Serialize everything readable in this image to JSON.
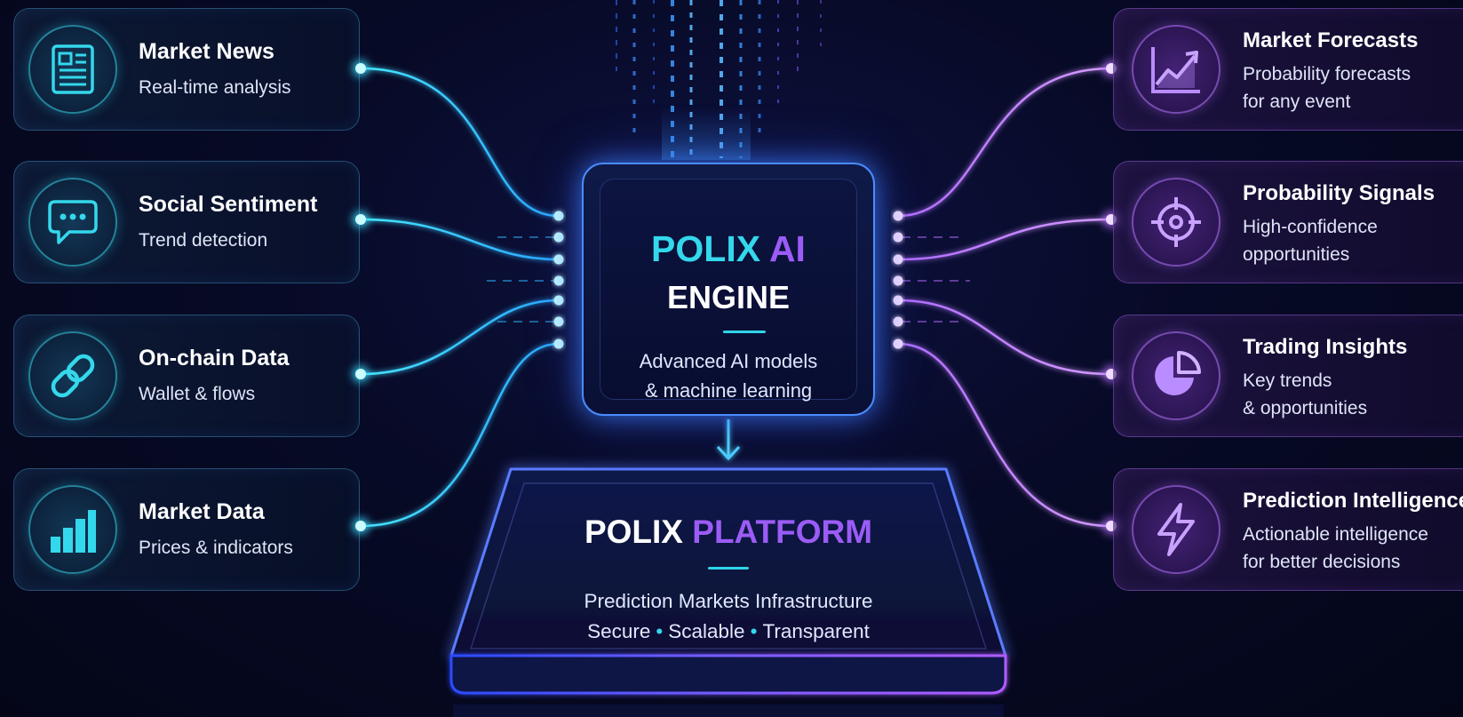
{
  "colors": {
    "cyan": "#34d8ec",
    "purple": "#9b5cf6",
    "background": "#070a26",
    "chip_border": "#4a8cff"
  },
  "inputs": [
    {
      "title": "Market News",
      "subtitle": "Real-time analysis",
      "icon": "newspaper-icon"
    },
    {
      "title": "Social Sentiment",
      "subtitle": "Trend detection",
      "icon": "chat-bubble-icon"
    },
    {
      "title": "On-chain Data",
      "subtitle": "Wallet & flows",
      "icon": "chain-link-icon"
    },
    {
      "title": "Market Data",
      "subtitle": "Prices & indicators",
      "icon": "bar-chart-icon"
    }
  ],
  "outputs": [
    {
      "title": "Market Forecasts",
      "lines": [
        "Probability forecasts",
        "for any event"
      ],
      "icon": "trend-chart-icon"
    },
    {
      "title": "Probability Signals",
      "lines": [
        "High-confidence",
        "opportunities"
      ],
      "icon": "crosshair-icon"
    },
    {
      "title": "Trading Insights",
      "lines": [
        "Key trends",
        "& opportunities"
      ],
      "icon": "pie-chart-icon"
    },
    {
      "title": "Prediction Intelligence",
      "lines": [
        "Actionable intelligence",
        "for better decisions"
      ],
      "icon": "lightning-icon"
    }
  ],
  "engine": {
    "title_part1": "POLIX",
    "title_part2": "AI",
    "title_line2": "ENGINE",
    "desc_line1": "Advanced AI models",
    "desc_line2": "& machine learning"
  },
  "platform": {
    "title_part1": "POLIX",
    "title_part2": "PLATFORM",
    "desc_line1": "Prediction Markets Infrastructure",
    "desc_items": [
      "Secure",
      "Scalable",
      "Transparent"
    ],
    "separator": "•"
  }
}
